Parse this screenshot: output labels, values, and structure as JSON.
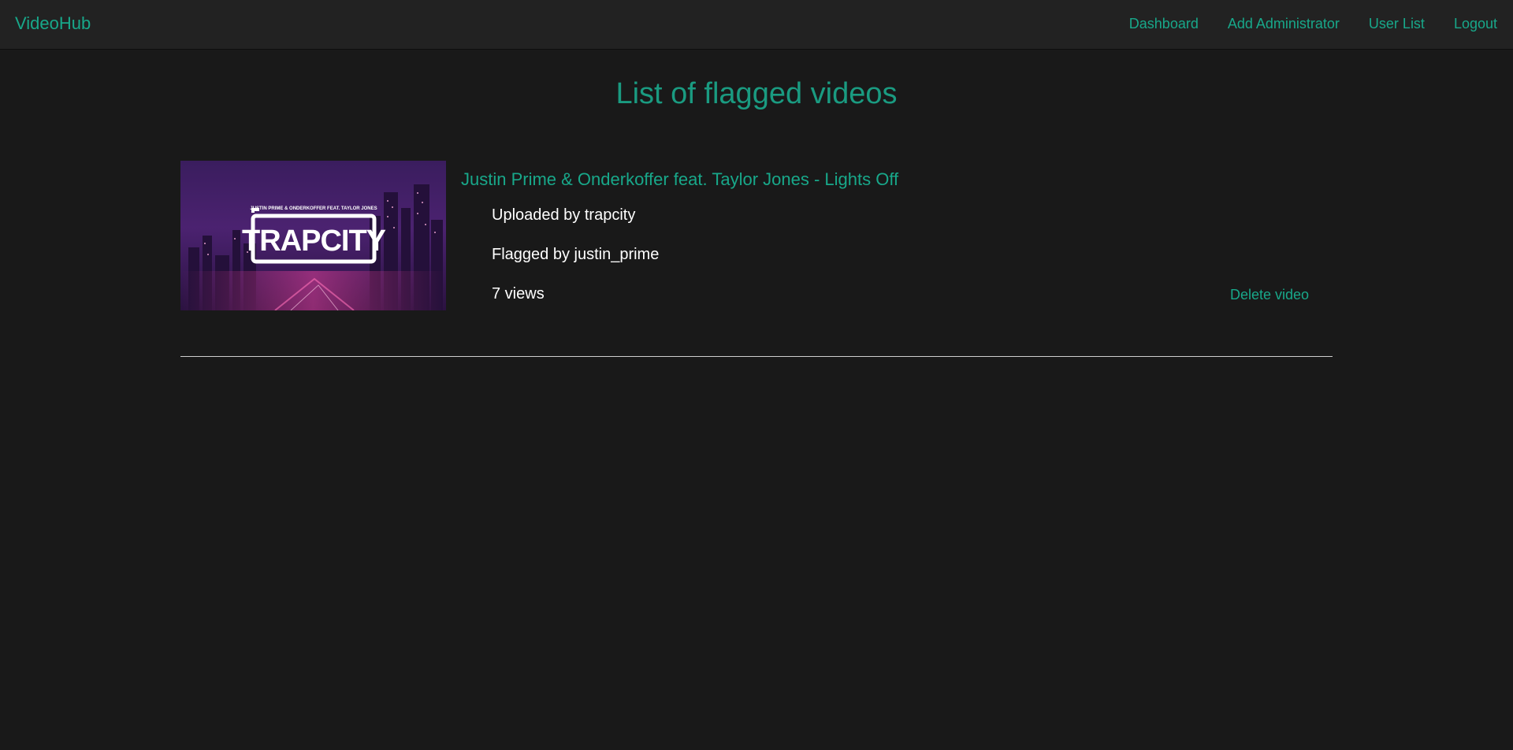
{
  "app": {
    "brand": "VideoHub"
  },
  "nav": {
    "items": [
      {
        "label": "Dashboard"
      },
      {
        "label": "Add Administrator"
      },
      {
        "label": "User List"
      },
      {
        "label": "Logout"
      }
    ]
  },
  "page": {
    "title": "List of flagged videos"
  },
  "videos": [
    {
      "title": "Justin Prime & Onderkoffer feat. Taylor Jones - Lights Off",
      "uploaded_by": "Uploaded by trapcity",
      "flagged_by": "Flagged by justin_prime",
      "views": "7 views",
      "delete_label": "Delete video",
      "thumbnail": {
        "logo_text": "TRAPCITY",
        "caption": "JUSTIN PRIME & ONDERKOFFER FEAT. TAYLOR JONES"
      }
    }
  ],
  "colors": {
    "accent": "#18a88a",
    "background": "#191919",
    "navbar": "#222222",
    "text": "#ffffff"
  }
}
